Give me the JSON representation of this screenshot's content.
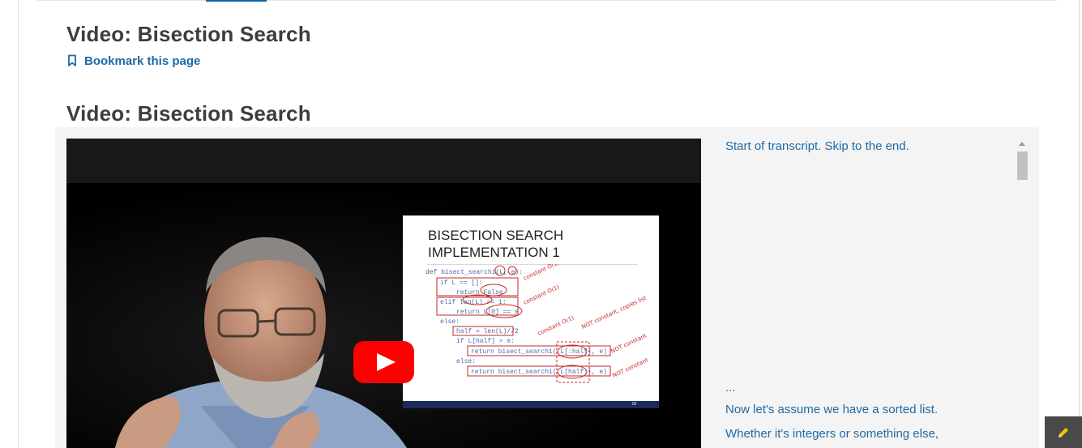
{
  "page": {
    "title": "Video: Bisection Search",
    "bookmark_label": "Bookmark this page"
  },
  "video_block": {
    "title": "Video: Bisection Search",
    "slide": {
      "title_line1": "BISECTION SEARCH",
      "title_line2": "IMPLEMENTATION 1",
      "code_lines": [
        "def bisect_search1(L, e):",
        "if L == []:",
        "return False",
        "elif len(L) == 1:",
        "return L[0] == e",
        "else:",
        "half = len(L)//2",
        "if L[half] > e:",
        "return bisect_search1( L[:half], e)",
        "else:",
        "return bisect_search1( L[half:], e)"
      ],
      "annotations": [
        "constant O(1)",
        "constant O(1)",
        "constant O(1)",
        "NOT constant, copies list",
        "NOT constant",
        "NOT constant"
      ],
      "footer_page": "18"
    },
    "transcript": {
      "skip_link": "Start of transcript. Skip to the end.",
      "ellipsis": "...",
      "line1": "Now let's assume we have a sorted list.",
      "line2": "Whether it's integers or something else,"
    }
  },
  "icons": {
    "bookmark": "bookmark-icon",
    "play": "youtube-play-icon",
    "edit": "pencil-icon"
  },
  "colors": {
    "link": "#1f6aa5",
    "youtube_red": "#ff0000",
    "edit_button": "#4a4a4a",
    "pencil": "#f2c200"
  }
}
